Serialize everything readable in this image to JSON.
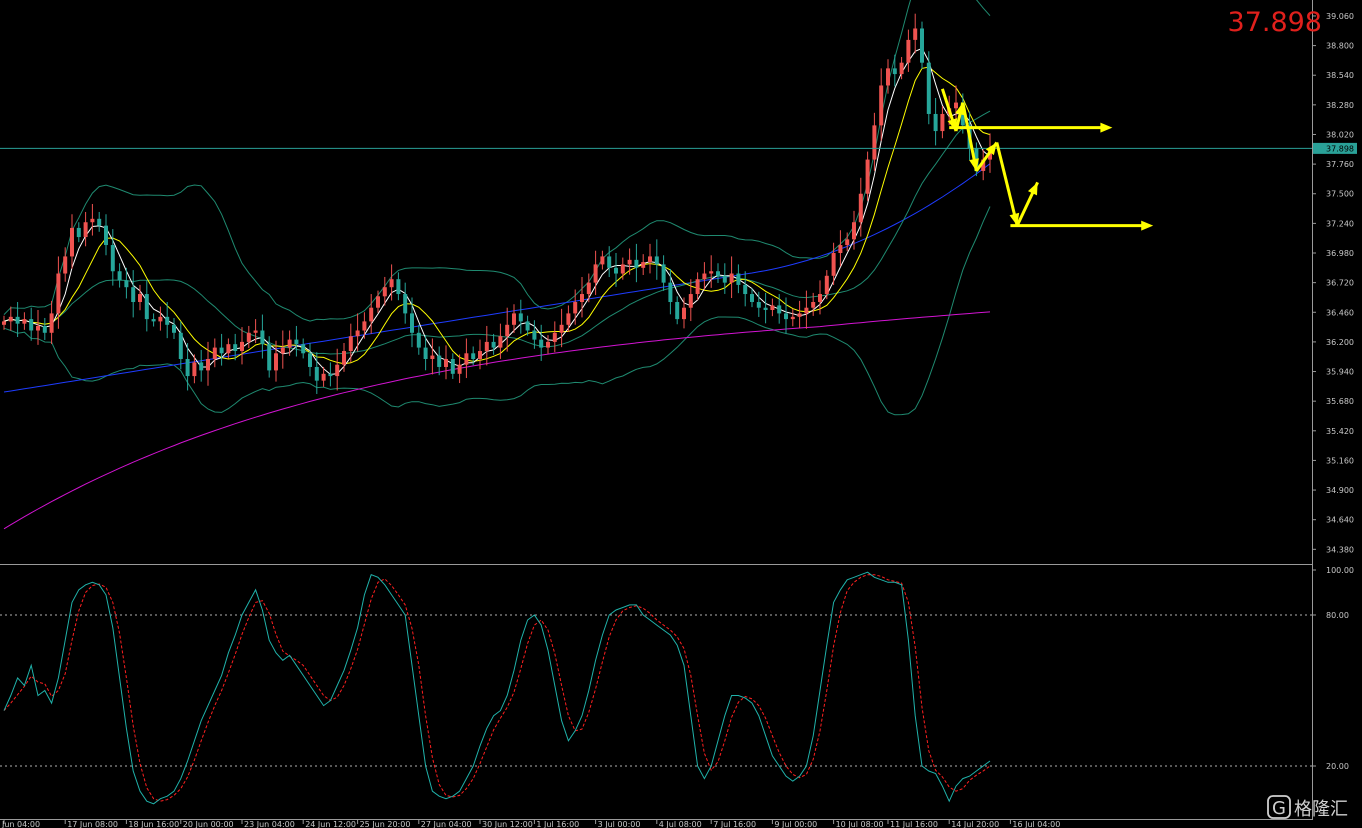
{
  "header": {
    "current_price": "37.898"
  },
  "price_tag": "37.898",
  "watermark": {
    "logo_letter": "G",
    "text": "格隆汇"
  },
  "colors": {
    "bull_candle": "#ef5350",
    "bear_candle": "#26a69a",
    "bollinger": "#1f8a70",
    "ma_fast": "#ffffff",
    "ma_mid": "#ffff00",
    "ma_blue": "#1e3cff",
    "ma_magenta": "#d214d2",
    "stoch_main": "#20b2aa",
    "stoch_signal": "#ff2020",
    "projection": "#ffff00",
    "price_line": "#2aa198",
    "axis_text": "#c8c8c8"
  },
  "chart_data": [
    {
      "type": "candlestick",
      "title": "",
      "price_axis_ticks": [
        "39.060",
        "38.800",
        "38.540",
        "38.280",
        "38.020",
        "37.760",
        "37.500",
        "37.240",
        "36.980",
        "36.720",
        "36.460",
        "36.200",
        "35.940",
        "35.680",
        "35.420",
        "35.160",
        "34.900",
        "34.640",
        "34.380"
      ],
      "ylim": [
        34.26,
        39.2
      ],
      "time_axis_labels": [
        "Jun 04:00",
        "17 Jun 08:00",
        "18 Jun 16:00",
        "20 Jun 00:00",
        "23 Jun 04:00",
        "24 Jun 12:00",
        "25 Jun 20:00",
        "27 Jun 04:00",
        "30 Jun 12:00",
        "1 Jul 16:00",
        "3 Jul 00:00",
        "4 Jul 08:00",
        "7 Jul 16:00",
        "9 Jul 00:00",
        "10 Jul 08:00",
        "11 Jul 16:00",
        "14 Jul 20:00",
        "16 Jul 04:00"
      ],
      "current_price": 37.898,
      "closes": [
        36.38,
        36.42,
        36.36,
        36.4,
        36.3,
        36.34,
        36.28,
        36.45,
        36.8,
        36.95,
        37.2,
        37.12,
        37.25,
        37.28,
        37.22,
        37.05,
        36.82,
        36.74,
        36.68,
        36.55,
        36.62,
        36.4,
        36.38,
        36.42,
        36.35,
        36.28,
        36.05,
        35.9,
        36.02,
        35.95,
        36.05,
        36.15,
        36.1,
        36.18,
        36.12,
        36.2,
        36.28,
        36.3,
        36.18,
        35.95,
        36.1,
        36.15,
        36.22,
        36.18,
        36.1,
        35.98,
        35.86,
        35.92,
        35.9,
        36.0,
        36.12,
        36.25,
        36.3,
        36.38,
        36.5,
        36.6,
        36.68,
        36.75,
        36.62,
        36.45,
        36.28,
        36.15,
        36.05,
        36.08,
        35.98,
        36.05,
        35.92,
        36.0,
        36.1,
        36.05,
        36.12,
        36.2,
        36.15,
        36.25,
        36.35,
        36.45,
        36.38,
        36.3,
        36.22,
        36.15,
        36.2,
        36.28,
        36.35,
        36.45,
        36.55,
        36.62,
        36.72,
        36.88,
        36.95,
        36.85,
        36.8,
        36.88,
        36.92,
        36.85,
        36.9,
        36.95,
        36.88,
        36.72,
        36.55,
        36.4,
        36.5,
        36.62,
        36.75,
        36.8,
        36.82,
        36.78,
        36.72,
        36.8,
        36.7,
        36.62,
        36.55,
        36.5,
        36.48,
        36.52,
        36.45,
        36.4,
        36.42,
        36.45,
        36.5,
        36.55,
        36.62,
        36.78,
        36.98,
        37.05,
        37.1,
        37.25,
        37.5,
        37.8,
        38.1,
        38.45,
        38.6,
        38.55,
        38.65,
        38.85,
        38.95,
        38.65,
        38.2,
        38.05,
        38.2,
        38.25,
        38.3,
        38.1,
        37.9,
        37.7,
        37.8,
        37.9
      ],
      "series": [
        {
          "name": "",
          "kind": "bollinger_upper"
        },
        {
          "name": "",
          "kind": "bollinger_middle"
        },
        {
          "name": "",
          "kind": "bollinger_lower"
        },
        {
          "name": "",
          "kind": "ma_fast"
        },
        {
          "name": "",
          "kind": "ma_mid"
        },
        {
          "name": "",
          "kind": "ma_slow"
        },
        {
          "name": "",
          "kind": "ma_long"
        }
      ],
      "projection": {
        "path": [
          [
            138,
            38.42
          ],
          [
            140,
            38.05
          ],
          [
            141,
            38.3
          ],
          [
            143,
            37.7
          ],
          [
            146,
            37.95
          ],
          [
            149,
            37.22
          ],
          [
            152,
            37.6
          ]
        ],
        "levels": [
          {
            "price": 38.08,
            "from_bar": 139,
            "to_bar": 163
          },
          {
            "price": 37.22,
            "from_bar": 148,
            "to_bar": 169
          }
        ]
      },
      "grid": false
    },
    {
      "type": "line",
      "title": "",
      "y_axis_ticks": [
        "100.00",
        "80.00",
        "20.00"
      ],
      "ylim": [
        0,
        100
      ],
      "levels": [
        80,
        20
      ],
      "series": [
        {
          "name": "",
          "values": [
            42,
            48,
            55,
            52,
            60,
            48,
            50,
            45,
            55,
            70,
            85,
            90,
            92,
            93,
            92,
            88,
            75,
            55,
            35,
            18,
            10,
            6,
            5,
            7,
            8,
            10,
            15,
            22,
            30,
            38,
            44,
            50,
            56,
            65,
            72,
            80,
            85,
            90,
            82,
            70,
            65,
            62,
            64,
            60,
            56,
            52,
            48,
            44,
            46,
            52,
            58,
            66,
            75,
            88,
            96,
            95,
            92,
            88,
            84,
            80,
            60,
            40,
            20,
            10,
            8,
            7,
            8,
            10,
            15,
            20,
            28,
            35,
            40,
            42,
            48,
            58,
            70,
            78,
            80,
            76,
            66,
            52,
            38,
            30,
            34,
            40,
            50,
            62,
            72,
            80,
            82,
            83,
            84,
            84,
            80,
            78,
            76,
            74,
            72,
            68,
            60,
            40,
            20,
            15,
            20,
            30,
            40,
            48,
            48,
            47,
            45,
            40,
            32,
            24,
            20,
            16,
            14,
            16,
            20,
            32,
            50,
            68,
            85,
            90,
            94,
            95,
            96,
            97,
            95,
            94,
            93,
            93,
            92,
            70,
            40,
            20,
            18,
            17,
            12,
            6,
            12,
            15,
            16,
            18,
            20,
            22
          ]
        }
      ],
      "grid": false
    }
  ]
}
